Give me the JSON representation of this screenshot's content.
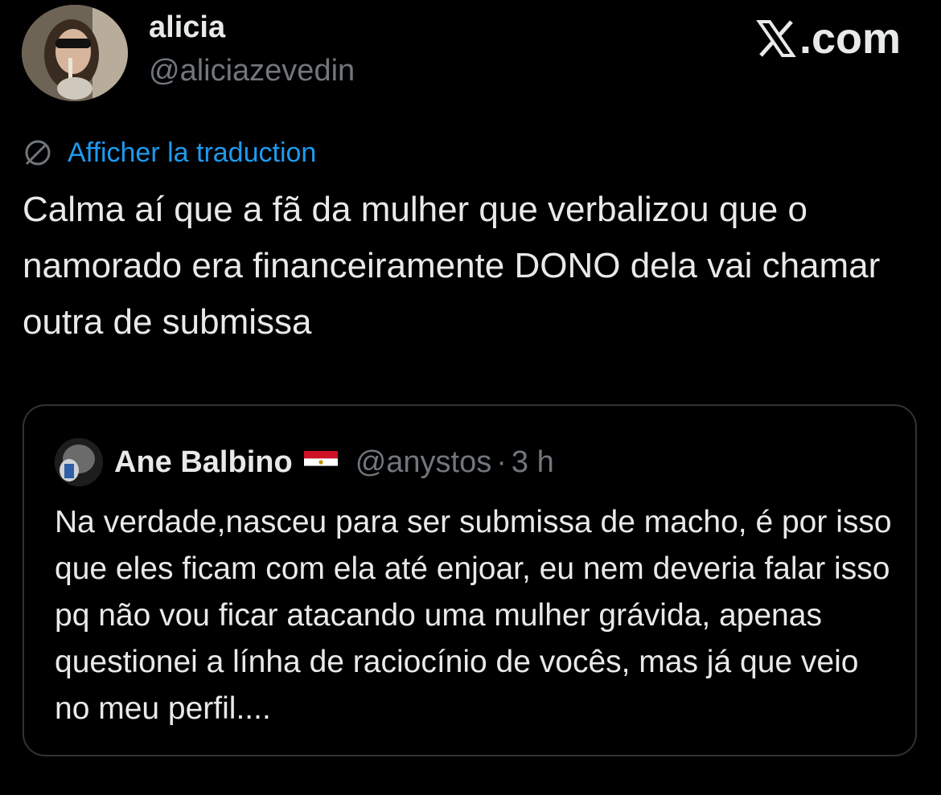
{
  "header": {
    "display_name": "alicia",
    "handle": "@aliciazevedin",
    "brand": ".com",
    "brand_icon": "x-logo-icon"
  },
  "translate": {
    "icon": "globe-icon",
    "label": "Afficher la traduction",
    "color": "#1d9bf0"
  },
  "tweet": {
    "text": "Calma aí que a fã da mulher que verbalizou que o namorado era financeiramente DONO dela vai chamar outra de submissa"
  },
  "quoted_tweet": {
    "display_name": "Ane Balbino",
    "flag": "egypt-flag-icon",
    "handle": "@anystos",
    "separator": "·",
    "time": "3 h",
    "text": "Na verdade,nasceu para ser submissa de macho, é por isso que eles ficam com ela até enjoar, eu nem deveria falar isso pq não vou ficar atacando uma mulher grávida, apenas questionei a línha de raciocínio de vocês, mas já que veio no meu perfil...."
  },
  "colors": {
    "background": "#000000",
    "text_primary": "#e7e9ea",
    "text_secondary": "#71767b",
    "border": "#2f3336"
  }
}
